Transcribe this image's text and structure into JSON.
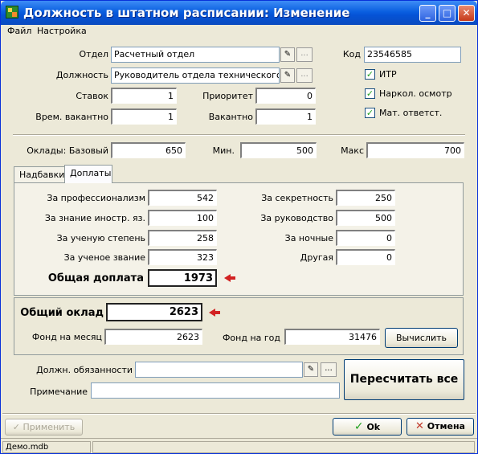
{
  "window": {
    "title": "Должность в штатном расписании: Изменение",
    "controls": {
      "minimize": "_",
      "maximize": "□",
      "close": "✕"
    }
  },
  "menu": {
    "file": "Файл",
    "settings": "Настройка"
  },
  "top": {
    "department_label": "Отдел",
    "department_value": "Расчетный отдел",
    "position_label": "Должность",
    "position_value": "Руководитель отдела технического контр",
    "code_label": "Код",
    "code_value": "23546585",
    "rates_label": "Ставок",
    "rates_value": "1",
    "priority_label": "Приоритет",
    "priority_value": "0",
    "temp_vacant_label": "Врем. вакантно",
    "temp_vacant_value": "1",
    "vacant_label": "Вакантно",
    "vacant_value": "1",
    "itr_label": "ИТР",
    "narco_label": "Наркол. осмотр",
    "mat_label": "Мат. ответст."
  },
  "salary": {
    "base_label": "Оклады: Базовый",
    "base_value": "650",
    "min_label": "Мин.",
    "min_value": "500",
    "max_label": "Макс",
    "max_value": "700"
  },
  "tabs": {
    "allowances": "Надбавки",
    "surcharges": "Доплаты"
  },
  "surcharges": {
    "professionalism_label": "За профессионализм",
    "professionalism_value": "542",
    "language_label": "За знание иностр. яз.",
    "language_value": "100",
    "degree_label": "За ученую степень",
    "degree_value": "258",
    "title_label": "За ученое звание",
    "title_value": "323",
    "secrecy_label": "За секретность",
    "secrecy_value": "250",
    "management_label": "За руководство",
    "management_value": "500",
    "night_label": "За ночные",
    "night_value": "0",
    "other_label": "Другая",
    "other_value": "0",
    "total_label": "Общая доплата",
    "total_value": "1973"
  },
  "totals": {
    "salary_label": "Общий оклад",
    "salary_value": "2623",
    "month_fund_label": "Фонд на месяц",
    "month_fund_value": "2623",
    "year_fund_label": "Фонд на год",
    "year_fund_value": "31476",
    "calc_button": "Вычислить"
  },
  "bottom": {
    "duties_label": "Должн. обязанности",
    "duties_value": "",
    "note_label": "Примечание",
    "note_value": "",
    "recalc_button": "Пересчитать все"
  },
  "footer": {
    "apply": "Применить",
    "ok": "Ok",
    "cancel": "Отмена"
  },
  "status": {
    "file": "Демо.mdb"
  },
  "icons": {
    "edit": "edit-icon",
    "dots": "...",
    "check": "✓"
  },
  "colors": {
    "title_bar": "#0553d6",
    "arrow": "#d22222",
    "ok_check": "#21a121",
    "cancel_x": "#c0392b"
  }
}
